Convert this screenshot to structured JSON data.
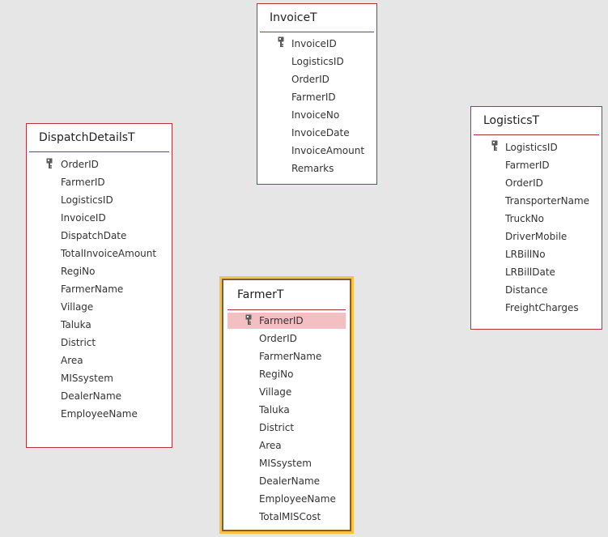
{
  "tables": {
    "invoice": {
      "title": "InvoiceT",
      "fields": [
        "InvoiceID",
        "LogisticsID",
        "OrderID",
        "FarmerID",
        "InvoiceNo",
        "InvoiceDate",
        "InvoiceAmount",
        "Remarks"
      ],
      "key_field": "InvoiceID"
    },
    "logistics": {
      "title": "LogisticsT",
      "fields": [
        "LogisticsID",
        "FarmerID",
        "OrderID",
        "TransporterName",
        "TruckNo",
        "DriverMobile",
        "LRBillNo",
        "LRBillDate",
        "Distance",
        "FreightCharges"
      ],
      "key_field": "LogisticsID"
    },
    "dispatch": {
      "title": "DispatchDetailsT",
      "fields": [
        "OrderID",
        "FarmerID",
        "LogisticsID",
        "InvoiceID",
        "DispatchDate",
        "TotalInvoiceAmount",
        "RegiNo",
        "FarmerName",
        "Village",
        "Taluka",
        "District",
        "Area",
        "MISsystem",
        "DealerName",
        "EmployeeName"
      ],
      "key_field": "OrderID"
    },
    "farmer": {
      "title": "FarmerT",
      "fields": [
        "FarmerID",
        "OrderID",
        "FarmerName",
        "RegiNo",
        "Village",
        "Taluka",
        "District",
        "Area",
        "MISsystem",
        "DealerName",
        "EmployeeName",
        "TotalMISCost"
      ],
      "key_field": "FarmerID",
      "selected_field": "FarmerID",
      "selected_table": true
    }
  },
  "colors": {
    "canvas_bg": "#e6e6e6",
    "border": "#b5343a",
    "selection_outline": "#f3c443",
    "field_selected_bg": "#f4bfc2"
  },
  "icons": {
    "primary_key": "key-icon"
  }
}
